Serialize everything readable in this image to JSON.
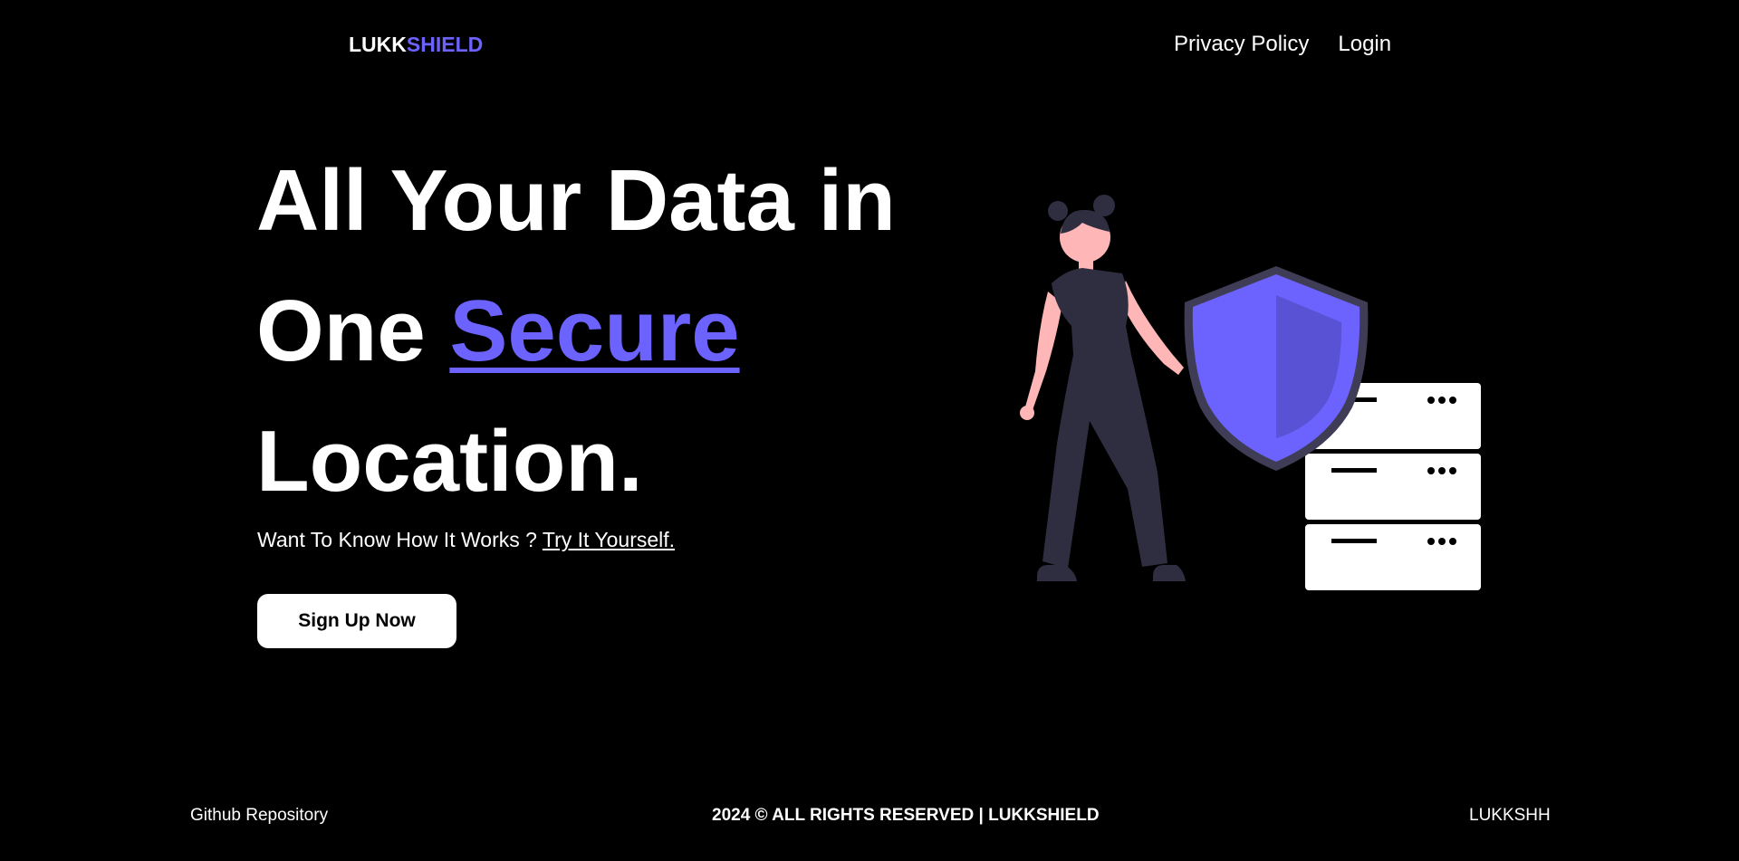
{
  "brand": {
    "part1": "LUKK",
    "part2": "SHIELD",
    "color_part2": "#6c63ff"
  },
  "nav": {
    "privacy": "Privacy Policy",
    "login": "Login"
  },
  "hero": {
    "line1": "All Your Data in",
    "line2_prefix": "One ",
    "line2_accent": "Secure",
    "line3": "Location.",
    "sub_text": "Want To Know How It Works ? ",
    "sub_link": "Try It Yourself.",
    "cta": "Sign Up Now"
  },
  "footer": {
    "left": "Github Repository",
    "center": "2024 © ALL RIGHTS RESERVED | LUKKSHIELD",
    "right": "LUKKSHH"
  },
  "colors": {
    "background": "#000000",
    "accent": "#6c63ff",
    "figure_dark": "#2f2e41",
    "skin": "#ffb6b6"
  }
}
